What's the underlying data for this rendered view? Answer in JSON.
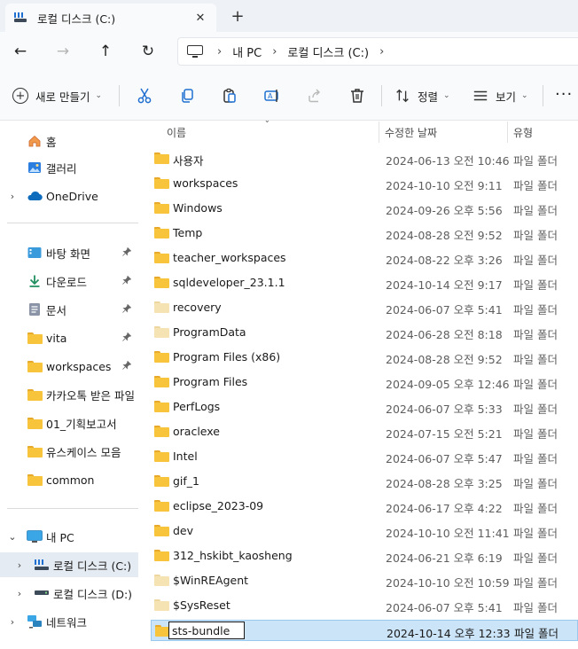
{
  "tab": {
    "title": "로컬 디스크 (C:)",
    "close_glyph": "✕",
    "new_tab_glyph": "+"
  },
  "nav": {
    "back_glyph": "←",
    "forward_glyph": "→",
    "up_glyph": "↑",
    "refresh_glyph": "↻",
    "breadcrumb": [
      "내 PC",
      "로컬 디스크 (C:)"
    ],
    "breadcrumb_sep": "›"
  },
  "toolbar": {
    "new_label": "새로 만들기",
    "sort_label": "정렬",
    "view_label": "보기",
    "more_glyph": "···",
    "chevron_glyph": "⌄"
  },
  "columns": {
    "name": "이름",
    "date": "수정한 날짜",
    "type": "유형"
  },
  "sidebar": {
    "quick": [
      {
        "label": "홈",
        "icon": "home-icon"
      },
      {
        "label": "갤러리",
        "icon": "gallery-icon"
      },
      {
        "label": "OneDrive",
        "icon": "cloud-icon",
        "caret": "›"
      }
    ],
    "pinned": [
      {
        "label": "바탕 화면",
        "icon": "desktop-icon",
        "pinned": true
      },
      {
        "label": "다운로드",
        "icon": "download-icon",
        "pinned": true
      },
      {
        "label": "문서",
        "icon": "document-icon",
        "pinned": true
      },
      {
        "label": "vita",
        "icon": "folder-icon",
        "pinned": true
      },
      {
        "label": "workspaces",
        "icon": "folder-icon",
        "pinned": true
      },
      {
        "label": "카카오톡 받은 파일",
        "icon": "folder-icon",
        "pinned": false
      },
      {
        "label": "01_기획보고서",
        "icon": "folder-icon",
        "pinned": false
      },
      {
        "label": "유스케이스 모음",
        "icon": "folder-icon",
        "pinned": false
      },
      {
        "label": "common",
        "icon": "folder-icon",
        "pinned": false
      }
    ],
    "tree": [
      {
        "label": "내 PC",
        "icon": "pc-icon",
        "caret": "⌄"
      },
      {
        "label": "로컬 디스크 (C:)",
        "icon": "drive-c-icon",
        "caret": "›",
        "selected": true
      },
      {
        "label": "로컬 디스크 (D:)",
        "icon": "drive-d-icon",
        "caret": "›"
      },
      {
        "label": "네트워크",
        "icon": "network-icon",
        "caret": "›"
      }
    ],
    "pin_glyph": "📌"
  },
  "files": [
    {
      "name": "사용자",
      "date": "2024-06-13 오전 10:46",
      "type": "파일 폴더",
      "pale": false
    },
    {
      "name": "workspaces",
      "date": "2024-10-10 오전 9:11",
      "type": "파일 폴더",
      "pale": false
    },
    {
      "name": "Windows",
      "date": "2024-09-26 오후 5:56",
      "type": "파일 폴더",
      "pale": false
    },
    {
      "name": "Temp",
      "date": "2024-08-28 오전 9:52",
      "type": "파일 폴더",
      "pale": false
    },
    {
      "name": "teacher_workspaces",
      "date": "2024-08-22 오후 3:26",
      "type": "파일 폴더",
      "pale": false
    },
    {
      "name": "sqldeveloper_23.1.1",
      "date": "2024-10-14 오전 9:17",
      "type": "파일 폴더",
      "pale": false
    },
    {
      "name": "recovery",
      "date": "2024-06-07 오후 5:41",
      "type": "파일 폴더",
      "pale": true
    },
    {
      "name": "ProgramData",
      "date": "2024-06-28 오전 8:18",
      "type": "파일 폴더",
      "pale": true
    },
    {
      "name": "Program Files (x86)",
      "date": "2024-08-28 오전 9:52",
      "type": "파일 폴더",
      "pale": false
    },
    {
      "name": "Program Files",
      "date": "2024-09-05 오후 12:46",
      "type": "파일 폴더",
      "pale": false
    },
    {
      "name": "PerfLogs",
      "date": "2024-06-07 오후 5:33",
      "type": "파일 폴더",
      "pale": false
    },
    {
      "name": "oraclexe",
      "date": "2024-07-15 오전 5:21",
      "type": "파일 폴더",
      "pale": false
    },
    {
      "name": "Intel",
      "date": "2024-06-07 오후 5:47",
      "type": "파일 폴더",
      "pale": false
    },
    {
      "name": "gif_1",
      "date": "2024-08-28 오후 3:25",
      "type": "파일 폴더",
      "pale": false
    },
    {
      "name": "eclipse_2023-09",
      "date": "2024-06-17 오후 4:22",
      "type": "파일 폴더",
      "pale": false
    },
    {
      "name": "dev",
      "date": "2024-10-10 오전 11:41",
      "type": "파일 폴더",
      "pale": false
    },
    {
      "name": "312_hskibt_kaosheng",
      "date": "2024-06-21 오후 6:19",
      "type": "파일 폴더",
      "pale": false
    },
    {
      "name": "$WinREAgent",
      "date": "2024-10-10 오전 10:59",
      "type": "파일 폴더",
      "pale": true
    },
    {
      "name": "$SysReset",
      "date": "2024-06-07 오후 5:41",
      "type": "파일 폴더",
      "pale": true
    },
    {
      "name": "sts-bundle",
      "date": "2024-10-14 오후 12:33",
      "type": "파일 폴더",
      "pale": false,
      "selected": true,
      "renaming": true
    }
  ],
  "colors": {
    "accent": "#1f6fd1",
    "folder": "#f7c43c",
    "selection": "#cce4f7",
    "sidebar_selected": "#e5ebf2"
  }
}
